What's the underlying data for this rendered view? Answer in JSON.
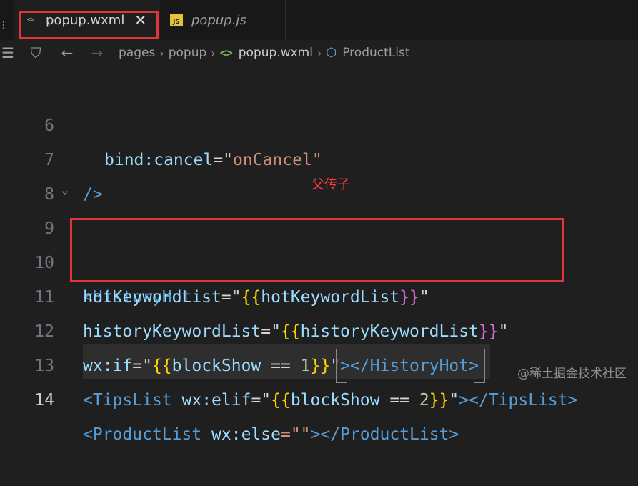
{
  "tabs": [
    {
      "label": "popup.wxml",
      "active": true,
      "close": "✕"
    },
    {
      "label": "popup.js",
      "active": false
    }
  ],
  "breadcrumb": {
    "items": [
      "pages",
      "popup",
      "popup.wxml",
      "ProductList"
    ]
  },
  "editor": {
    "lines": [
      {
        "number": "6"
      },
      {
        "number": "7"
      },
      {
        "number": "8"
      },
      {
        "number": "9"
      },
      {
        "number": "10"
      },
      {
        "number": "11"
      },
      {
        "number": "12"
      },
      {
        "number": "13"
      },
      {
        "number": "14"
      }
    ],
    "tokens": {
      "l6_attr": "bind:cancel",
      "l6_eq": "=\"",
      "l6_val": "onCancel",
      "l6_q": "\"",
      "l7": "/>",
      "l9_lt": "<",
      "l9_tag": "HistoryHot",
      "l10_attr": "hotKeywordList",
      "l10_eq": "=\"",
      "l10_ob": "{{",
      "l10_var": "hotKeywordList",
      "l10_cb": "}}",
      "l10_q": "\"",
      "l11_attr": "historyKeywordList",
      "l11_eq": "=\"",
      "l11_ob": "{{",
      "l11_var": "historyKeywordList",
      "l11_cb": "}}",
      "l11_q": "\"",
      "l12_attr": "wx:if",
      "l12_eq": "=\"",
      "l12_ob": "{{",
      "l12_var": "blockShow",
      "l12_op": " == ",
      "l12_num": "1",
      "l12_cb": "}}",
      "l12_q": "\"",
      "l12_gt": "></",
      "l12_tag": "HistoryHot",
      "l12_end": ">",
      "l13_lt": "<",
      "l13_tag": "TipsList",
      "l13_attr": "wx:elif",
      "l13_eq": "=\"",
      "l13_ob": "{{",
      "l13_var": "blockShow",
      "l13_op": " == ",
      "l13_num": "2",
      "l13_cb": "}}",
      "l13_q": "\"",
      "l13_gt": "></",
      "l13_tag2": "TipsList",
      "l13_end": ">",
      "l14_lt": "<",
      "l14_tag": "ProductList",
      "l14_attr": "wx:else",
      "l14_eq": "=\"\"",
      "l14_gt": ">",
      "l14_close": "</",
      "l14_tag2": "ProductList",
      "l14_end": ">"
    }
  },
  "annotation": "父传子",
  "watermark": "@稀土掘金技术社区",
  "colors": {
    "highlight_border": "#e0353a",
    "annotation": "#ff3b3b"
  }
}
